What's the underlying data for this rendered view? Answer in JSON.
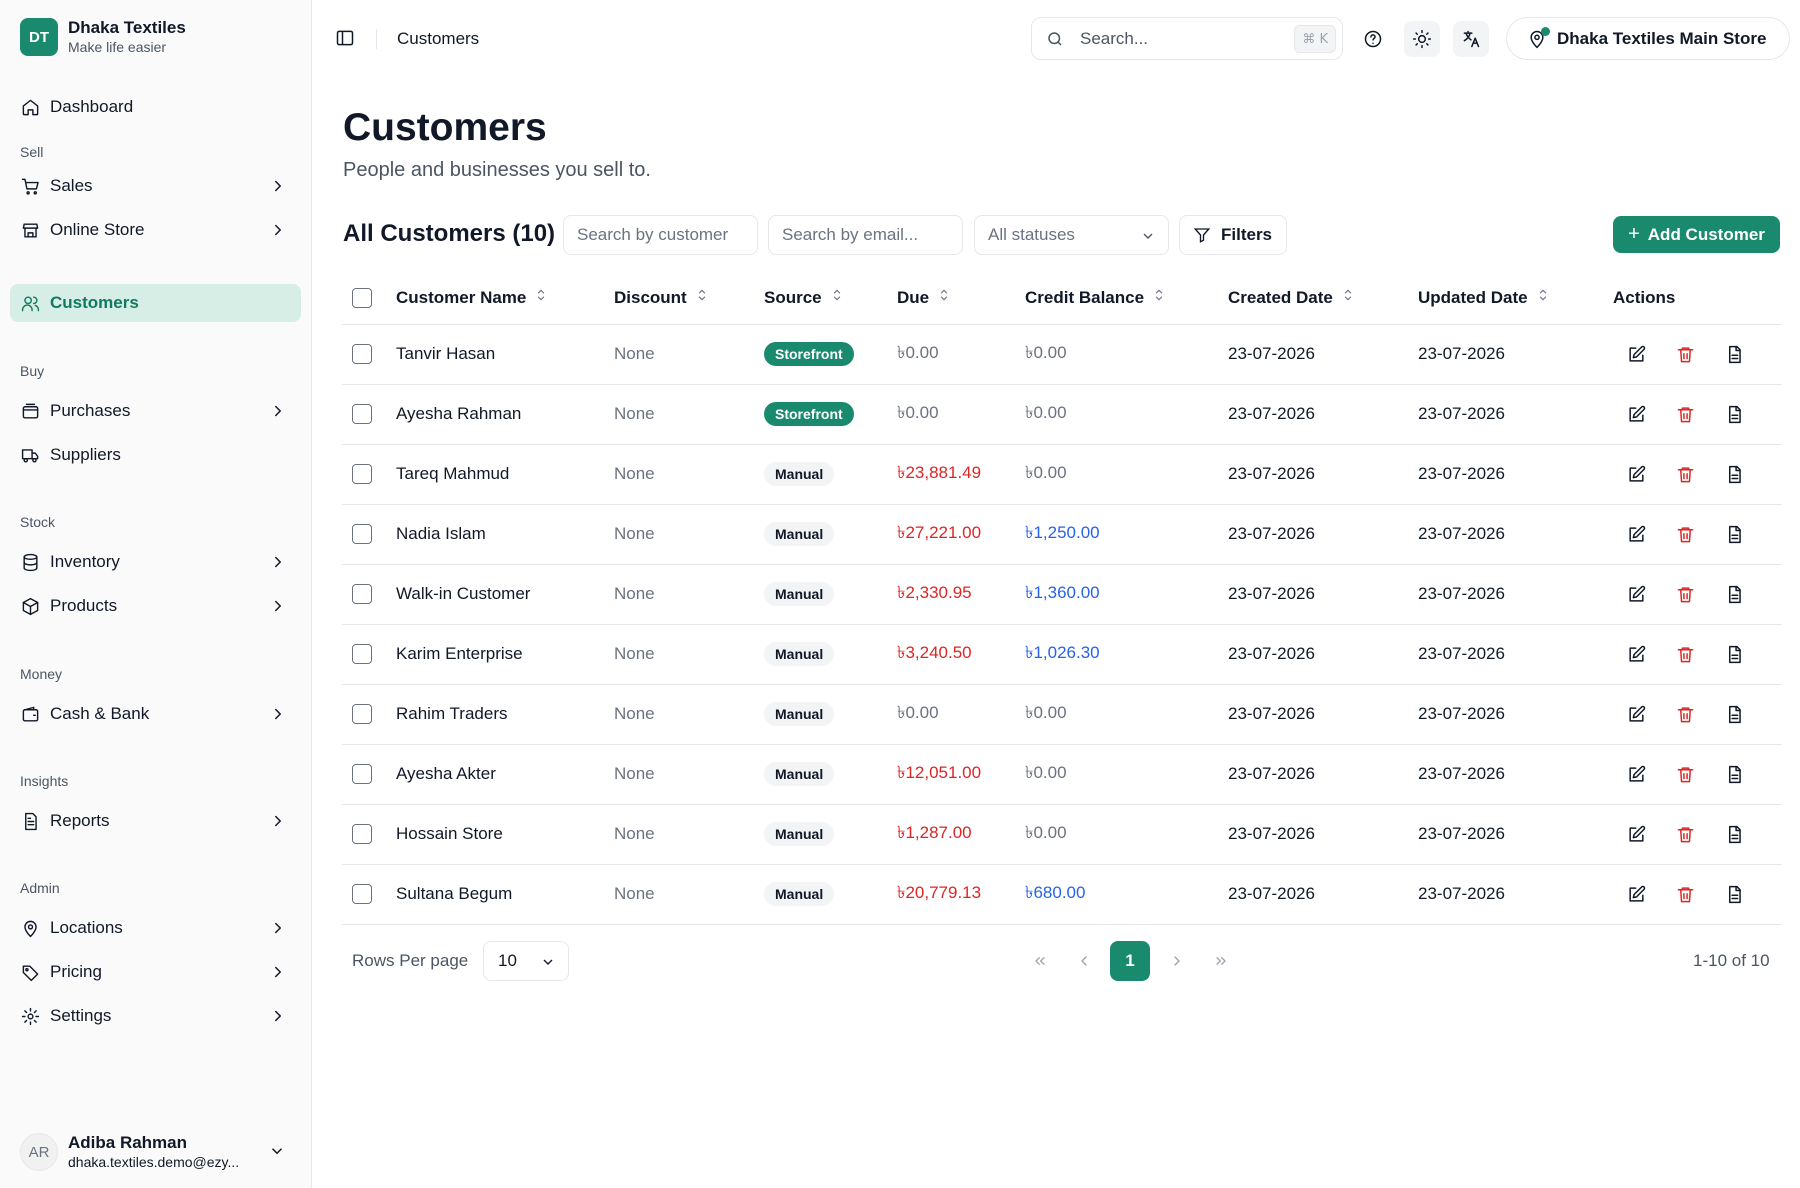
{
  "brand": {
    "initials": "DT",
    "name": "Dhaka Textiles",
    "tagline": "Make life easier"
  },
  "sidebar": {
    "dashboard": "Dashboard",
    "sections": {
      "sell": "Sell",
      "buy": "Buy",
      "stock": "Stock",
      "money": "Money",
      "insights": "Insights",
      "admin": "Admin"
    },
    "items": {
      "sales": "Sales",
      "online_store": "Online Store",
      "customers": "Customers",
      "purchases": "Purchases",
      "suppliers": "Suppliers",
      "inventory": "Inventory",
      "products": "Products",
      "cash_bank": "Cash & Bank",
      "reports": "Reports",
      "locations": "Locations",
      "pricing": "Pricing",
      "settings": "Settings"
    },
    "active": "customers"
  },
  "user": {
    "initials": "AR",
    "name": "Adiba Rahman",
    "email": "dhaka.textiles.demo@ezy..."
  },
  "topbar": {
    "breadcrumb": "Customers",
    "search_placeholder": "Search...",
    "search_shortcut": "⌘ K",
    "store": "Dhaka Textiles Main Store"
  },
  "page": {
    "title": "Customers",
    "subtitle": "People and businesses you sell to."
  },
  "list": {
    "title": "All Customers (10)",
    "search_customer_placeholder": "Search by customer",
    "search_email_placeholder": "Search by email...",
    "status_filter": "All statuses",
    "filters_label": "Filters",
    "add_label": "Add Customer"
  },
  "table": {
    "columns": {
      "name": "Customer Name",
      "discount": "Discount",
      "source": "Source",
      "due": "Due",
      "credit": "Credit Balance",
      "created": "Created Date",
      "updated": "Updated Date",
      "actions": "Actions"
    },
    "rows": [
      {
        "name": "Tanvir Hasan",
        "discount": "None",
        "source": "Storefront",
        "due": "৳0.00",
        "credit": "৳0.00",
        "created": "23-07-2026",
        "updated": "23-07-2026"
      },
      {
        "name": "Ayesha Rahman",
        "discount": "None",
        "source": "Storefront",
        "due": "৳0.00",
        "credit": "৳0.00",
        "created": "23-07-2026",
        "updated": "23-07-2026"
      },
      {
        "name": "Tareq Mahmud",
        "discount": "None",
        "source": "Manual",
        "due": "৳23,881.49",
        "credit": "৳0.00",
        "created": "23-07-2026",
        "updated": "23-07-2026"
      },
      {
        "name": "Nadia Islam",
        "discount": "None",
        "source": "Manual",
        "due": "৳27,221.00",
        "credit": "৳1,250.00",
        "created": "23-07-2026",
        "updated": "23-07-2026"
      },
      {
        "name": "Walk-in Customer",
        "discount": "None",
        "source": "Manual",
        "due": "৳2,330.95",
        "credit": "৳1,360.00",
        "created": "23-07-2026",
        "updated": "23-07-2026"
      },
      {
        "name": "Karim Enterprise",
        "discount": "None",
        "source": "Manual",
        "due": "৳3,240.50",
        "credit": "৳1,026.30",
        "created": "23-07-2026",
        "updated": "23-07-2026"
      },
      {
        "name": "Rahim Traders",
        "discount": "None",
        "source": "Manual",
        "due": "৳0.00",
        "credit": "৳0.00",
        "created": "23-07-2026",
        "updated": "23-07-2026"
      },
      {
        "name": "Ayesha Akter",
        "discount": "None",
        "source": "Manual",
        "due": "৳12,051.00",
        "credit": "৳0.00",
        "created": "23-07-2026",
        "updated": "23-07-2026"
      },
      {
        "name": "Hossain Store",
        "discount": "None",
        "source": "Manual",
        "due": "৳1,287.00",
        "credit": "৳0.00",
        "created": "23-07-2026",
        "updated": "23-07-2026"
      },
      {
        "name": "Sultana Begum",
        "discount": "None",
        "source": "Manual",
        "due": "৳20,779.13",
        "credit": "৳680.00",
        "created": "23-07-2026",
        "updated": "23-07-2026"
      }
    ]
  },
  "pagination": {
    "rows_label": "Rows Per page",
    "rows_value": "10",
    "current_page": "1",
    "range": "1-10 of 10"
  },
  "colors": {
    "accent": "#1a8a6e",
    "negative": "#dc2626",
    "positive": "#2563eb"
  }
}
